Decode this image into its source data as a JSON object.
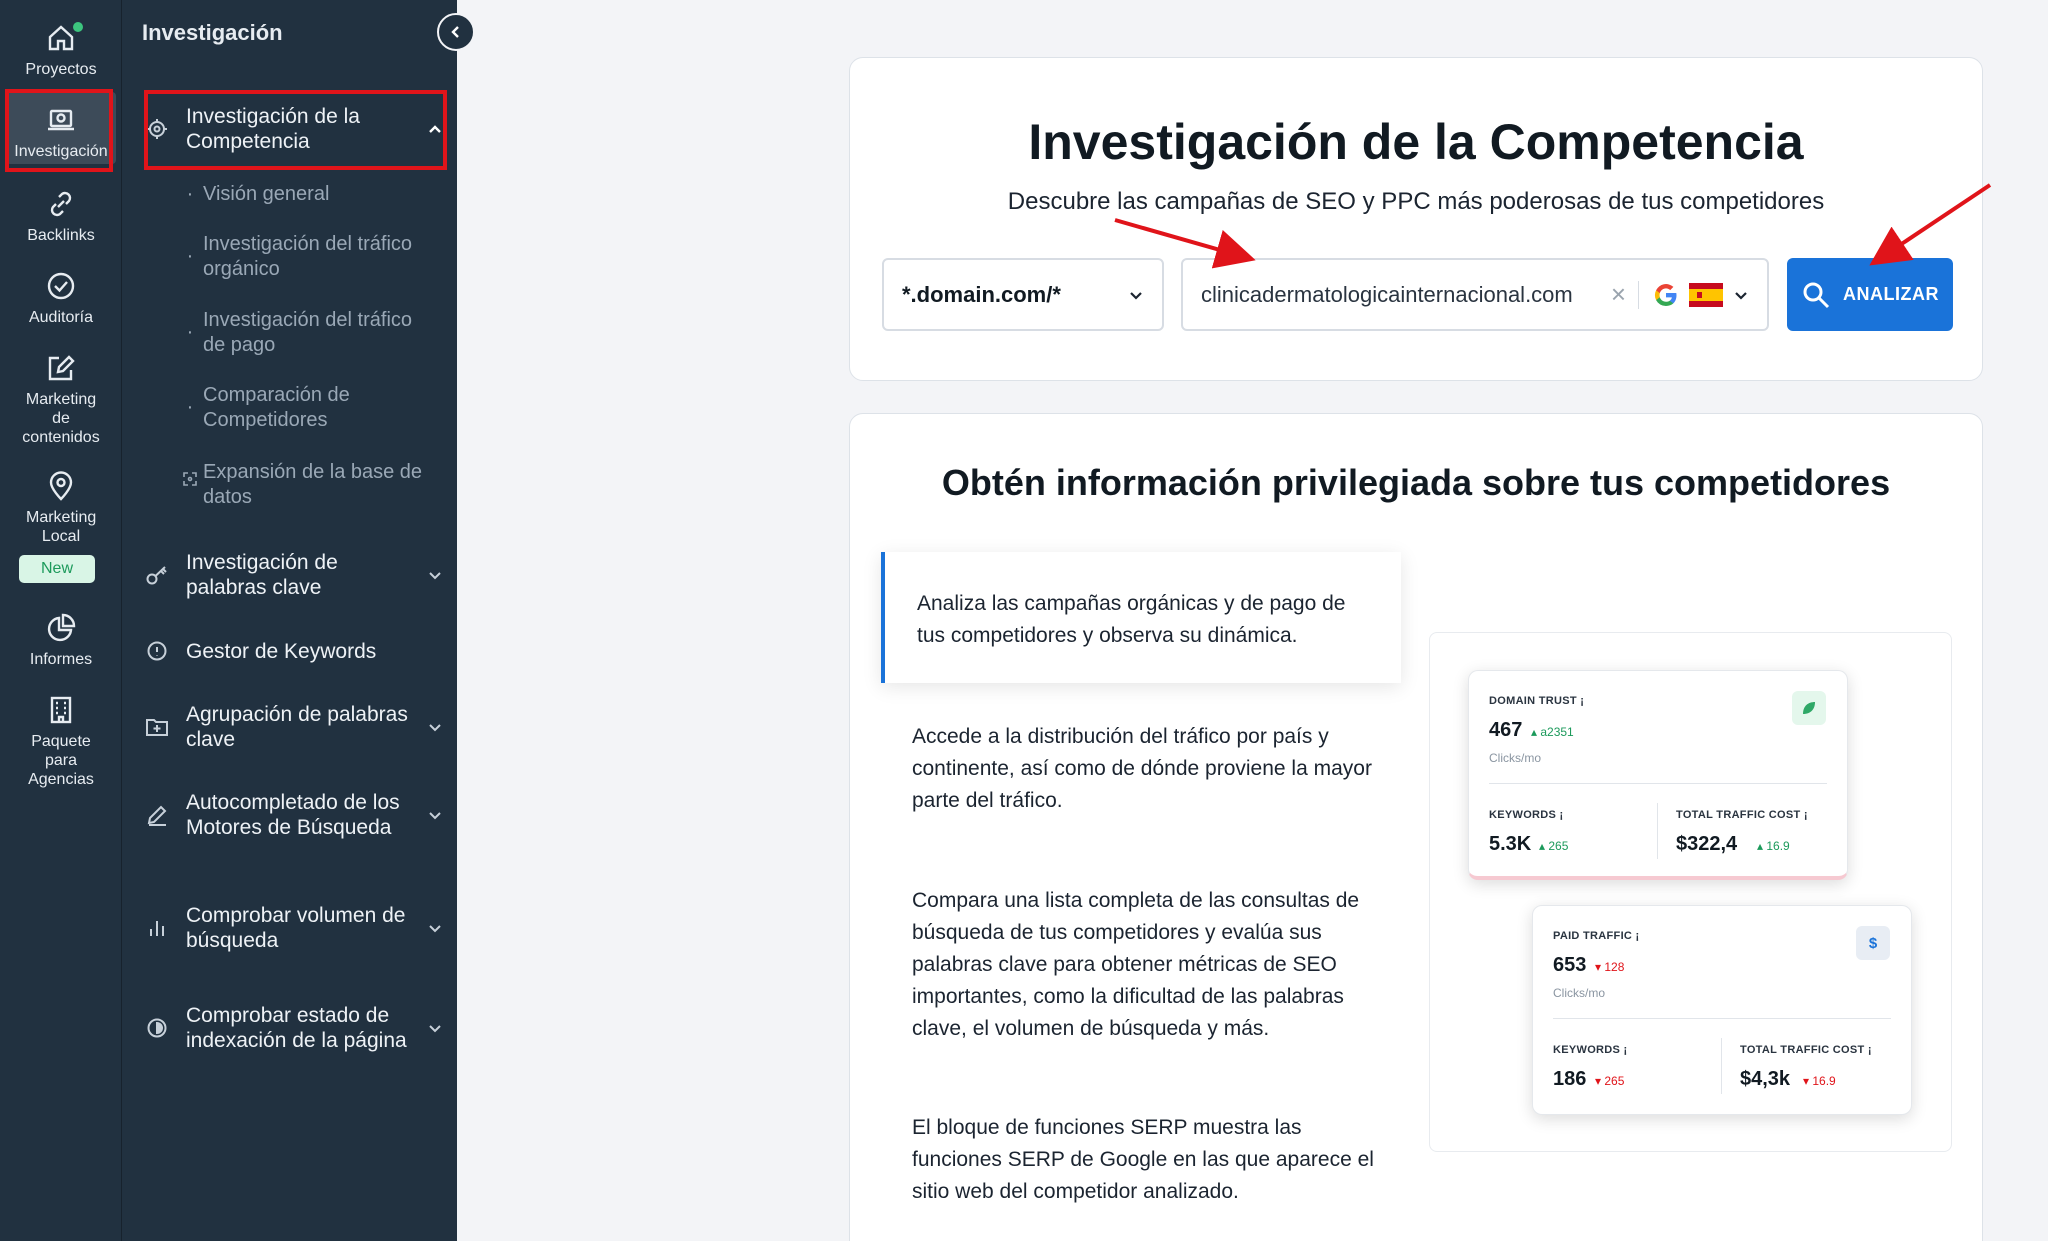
{
  "rail": {
    "items": [
      {
        "label": "Proyectos",
        "icon": "home-icon"
      },
      {
        "label": "Investigación",
        "icon": "research-icon"
      },
      {
        "label": "Backlinks",
        "icon": "link-icon"
      },
      {
        "label": "Auditoría",
        "icon": "check-circle-icon"
      },
      {
        "label": "Marketing de contenidos",
        "icon": "edit-icon"
      },
      {
        "label": "Marketing Local",
        "icon": "map-pin-icon"
      },
      {
        "label": "Informes",
        "icon": "pie-chart-icon"
      },
      {
        "label": "Paquete para Agencias",
        "icon": "building-icon"
      }
    ],
    "new_badge": "New"
  },
  "subnav": {
    "title": "Investigación",
    "items": [
      {
        "label": "Investigación de la Competencia",
        "icon": "target-icon"
      },
      {
        "label": "Investigación de palabras clave",
        "icon": "key-icon"
      },
      {
        "label": "Gestor de Keywords",
        "icon": "info-circle-icon"
      },
      {
        "label": "Agrupación de palabras clave",
        "icon": "folder-plus-icon"
      },
      {
        "label": "Autocompletado de los Motores de Búsqueda",
        "icon": "pen-icon"
      },
      {
        "label": "Comprobar volumen de búsqueda",
        "icon": "bar-chart-icon"
      },
      {
        "label": "Comprobar estado de indexación de la página",
        "icon": "half-circle-icon"
      }
    ],
    "subitems": [
      {
        "label": "Visión general"
      },
      {
        "label": "Investigación del tráfico orgánico"
      },
      {
        "label": "Investigación del tráfico de pago"
      },
      {
        "label": "Comparación de Competidores"
      },
      {
        "label": "Expansión de la base de datos"
      }
    ]
  },
  "hero": {
    "title": "Investigación de la Competencia",
    "subtitle": "Descubre las campañas de SEO y PPC más poderosas de tus competidores",
    "scope_select": "*.domain.com/*",
    "domain_value": "clinicadermatologicainternacional.com",
    "analyze_label": "ANALIZAR"
  },
  "info": {
    "title": "Obtén información privilegiada sobre tus competidores",
    "features": [
      "Analiza las campañas orgánicas y de pago de tus competidores y observa su dinámica.",
      "Accede a la distribución del tráfico por país y continente, así como de dónde proviene la mayor parte del tráfico.",
      "Compara una lista completa de las consultas de búsqueda de tus competidores y evalúa sus palabras clave para obtener métricas de SEO importantes, como la dificultad de las palabras clave, el volumen de búsqueda y más.",
      "El bloque de funciones SERP muestra las funciones SERP de Google en las que aparece el sitio web del competidor analizado."
    ]
  },
  "mock1": {
    "trust_label": "DOMAIN TRUST ¡",
    "trust_value": "467",
    "trust_delta": "▴ a2351",
    "trust_unit": "Clicks/mo",
    "kw_label": "KEYWORDS ¡",
    "kw_value": "5.3K",
    "kw_delta": "▴ 265",
    "cost_label": "TOTAL TRAFFIC COST ¡",
    "cost_value": "$322,4",
    "cost_delta": "▴ 16.9"
  },
  "mock2": {
    "paid_label": "PAID TRAFFIC ¡",
    "paid_value": "653",
    "paid_delta": "▾ 128",
    "paid_unit": "Clicks/mo",
    "kw_label": "KEYWORDS ¡",
    "kw_value": "186",
    "kw_delta": "▾ 265",
    "cost_label": "TOTAL TRAFFIC COST ¡",
    "cost_value": "$4,3k",
    "cost_delta": "▾ 16.9",
    "dollar": "$"
  }
}
